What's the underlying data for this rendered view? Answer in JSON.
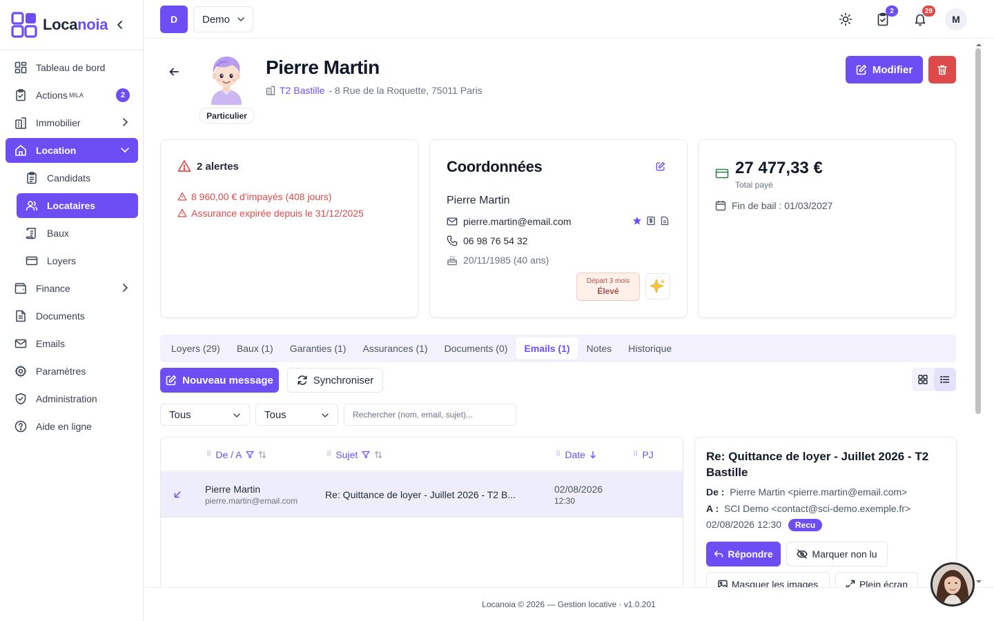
{
  "app": {
    "name_part1": "Loca",
    "name_part2": "noia"
  },
  "sidebar": {
    "items": [
      {
        "label": "Tableau de bord"
      },
      {
        "label": "Actions",
        "sup": "MILA",
        "badge": "2"
      },
      {
        "label": "Immobilier"
      },
      {
        "label": "Location"
      },
      {
        "label": "Candidats"
      },
      {
        "label": "Locataires"
      },
      {
        "label": "Baux"
      },
      {
        "label": "Loyers"
      },
      {
        "label": "Finance"
      },
      {
        "label": "Documents"
      },
      {
        "label": "Emails"
      },
      {
        "label": "Paramètres"
      },
      {
        "label": "Administration"
      },
      {
        "label": "Aide en ligne"
      }
    ]
  },
  "topbar": {
    "org_initial": "D",
    "org_name": "Demo",
    "tasks_badge": "2",
    "notif_badge": "29",
    "user_initial": "M"
  },
  "tenant": {
    "name": "Pierre Martin",
    "type": "Particulier",
    "property_link": "T2 Bastille",
    "address": "- 8 Rue de la Roquette, 75011 Paris"
  },
  "actions": {
    "edit_label": "Modifier"
  },
  "alerts": {
    "title": "2 alertes",
    "items": [
      "8 960,00 € d'impayés (408 jours)",
      "Assurance expirée depuis le 31/12/2025"
    ]
  },
  "contact": {
    "title": "Coordonnées",
    "name": "Pierre Martin",
    "email": "pierre.martin@email.com",
    "phone": "06 98 76 54 32",
    "birth": "20/11/1985 (40 ans)",
    "risk_label": "Départ 3 mois",
    "risk_value": "Élevé"
  },
  "payment": {
    "total": "27 477,33 €",
    "total_label": "Total payé",
    "lease_end": "Fin de bail : 01/03/2027"
  },
  "tabs": [
    {
      "label": "Loyers (29)"
    },
    {
      "label": "Baux (1)"
    },
    {
      "label": "Garanties (1)"
    },
    {
      "label": "Assurances (1)"
    },
    {
      "label": "Documents (0)"
    },
    {
      "label": "Emails (1)",
      "active": true
    },
    {
      "label": "Notes"
    },
    {
      "label": "Historique"
    }
  ],
  "email_toolbar": {
    "new_label": "Nouveau message",
    "sync_label": "Synchroniser"
  },
  "filters": {
    "filter1": "Tous",
    "filter2": "Tous",
    "search_placeholder": "Rechercher (nom, email, sujet)..."
  },
  "table": {
    "headers": {
      "from": "De / A",
      "subject": "Sujet",
      "date": "Date",
      "pj": "PJ"
    },
    "rows": [
      {
        "name": "Pierre Martin",
        "email": "pierre.martin@email.com",
        "subject": "Re: Quittance de loyer - Juillet 2026 - T2 B...",
        "date": "02/08/2026",
        "time": "12:30"
      }
    ]
  },
  "preview": {
    "subject": "Re: Quittance de loyer - Juillet 2026 - T2 Bastille",
    "from_label": "De :",
    "from": "Pierre Martin <pierre.martin@email.com>",
    "to_label": "A :",
    "to": "SCI Demo <contact@sci-demo.exemple.fr>",
    "datetime": "02/08/2026 12:30",
    "status": "Recu",
    "reply_label": "Répondre",
    "mark_unread_label": "Marquer non lu",
    "hide_images_label": "Masquer les images",
    "fullscreen_label": "Plein écran"
  },
  "footer": {
    "text": "Locanoia © 2026 — Gestion locative · v1.0.201"
  },
  "colors": {
    "primary": "#6d4ef4",
    "danger": "#dc4a4a",
    "success": "#2f7d4a"
  }
}
